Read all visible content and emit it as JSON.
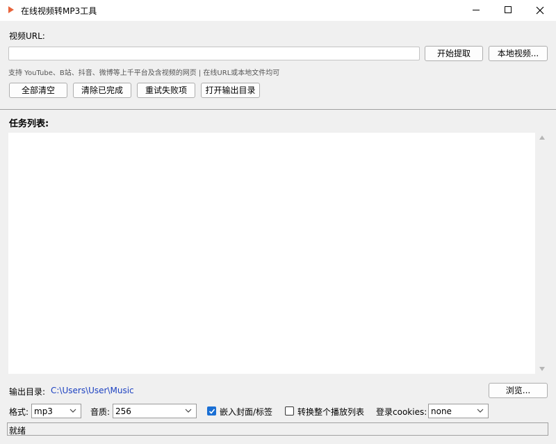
{
  "window": {
    "title": "在线视频转MP3工具"
  },
  "url": {
    "label": "视频URL:",
    "value": "",
    "start_button": "开始提取",
    "local_button": "本地视频...",
    "hint": "支持 YouTube、B站、抖音、微博等上千平台及含视频的网页 | 在线URL或本地文件均可"
  },
  "actions": {
    "clear_all": "全部清空",
    "clear_done": "清除已完成",
    "retry_failed": "重试失败项",
    "open_output": "打开输出目录"
  },
  "tasks": {
    "title": "任务列表:",
    "items": []
  },
  "output": {
    "label": "输出目录:",
    "path": "C:\\Users\\User\\Music",
    "browse_button": "浏览..."
  },
  "options": {
    "format_label": "格式:",
    "format_value": "mp3",
    "quality_label": "音质:",
    "quality_value": "256",
    "embed_label": "嵌入封面/标签",
    "embed_checked": true,
    "playlist_label": "转换整个播放列表",
    "playlist_checked": false,
    "cookies_label": "登录cookies:",
    "cookies_value": "none"
  },
  "status": {
    "text": "就绪"
  },
  "colors": {
    "accent": "#1a6fd4",
    "path_link": "#1a3fc0",
    "app_icon": "#e8643c"
  }
}
